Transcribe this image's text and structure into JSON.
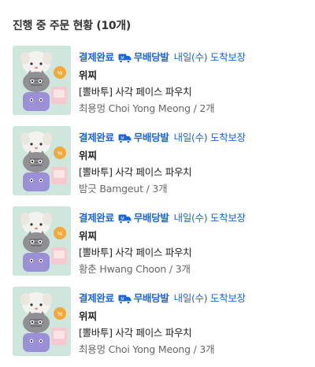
{
  "header": {
    "title": "진행 중 주문 현황 (10개)"
  },
  "colors": {
    "accent": "#1b65d9",
    "thumb_bg": "#cfe6dc"
  },
  "orders": [
    {
      "status": "결제완료",
      "shipping_badge": "무배당발",
      "arrival": "내일(수) 도착보장",
      "brand": "위찌",
      "product": "[뽈바투] 사각 페이스 파우치",
      "option": "최용멍 Choi Yong Meong / 2개"
    },
    {
      "status": "결제완료",
      "shipping_badge": "무배당발",
      "arrival": "내일(수) 도착보장",
      "brand": "위찌",
      "product": "[뽈바투] 사각 페이스 파우치",
      "option": "밤긋 Bamgeut / 3개"
    },
    {
      "status": "결제완료",
      "shipping_badge": "무배당발",
      "arrival": "내일(수) 도착보장",
      "brand": "위찌",
      "product": "[뽈바투] 사각 페이스 파우치",
      "option": "황춘 Hwang Choon / 3개"
    },
    {
      "status": "결제완료",
      "shipping_badge": "무배당발",
      "arrival": "내일(수) 도착보장",
      "brand": "위찌",
      "product": "[뽈바투] 사각 페이스 파우치",
      "option": "최용멍 Choi Yong Meong / 3개"
    }
  ]
}
